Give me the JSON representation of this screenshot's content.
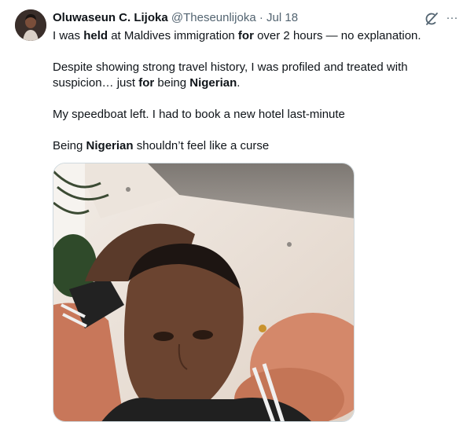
{
  "tweet": {
    "author": {
      "name": "Oluwaseun C. Lijoka",
      "handle": "@Theseunlijoka",
      "separator": "·",
      "date": "Jul 18",
      "avatar": "avatar-photo"
    },
    "actions": {
      "grok_icon": "grok-icon",
      "more_label": "···"
    },
    "text": {
      "p1": {
        "a": "I was ",
        "b": "held",
        "c": " at Maldives immigration ",
        "d": "for",
        "e": " over 2 hours — no explanation."
      },
      "p2": {
        "a": "Despite showing strong travel history, I was profiled and treated with suspicion… just ",
        "b": "for",
        "c": " being ",
        "d": "Nigerian",
        "e": "."
      },
      "p3": "My speedboat left. I had to book a new hotel last-minute",
      "p4": {
        "a": "Being ",
        "b": "Nigerian",
        "c": " shouldn’t feel like a curse"
      }
    },
    "media": {
      "type": "photo",
      "description_icon": "selfie-photo"
    }
  },
  "colors": {
    "text": "#0f1419",
    "secondary": "#536471",
    "border": "#cfd9de"
  }
}
